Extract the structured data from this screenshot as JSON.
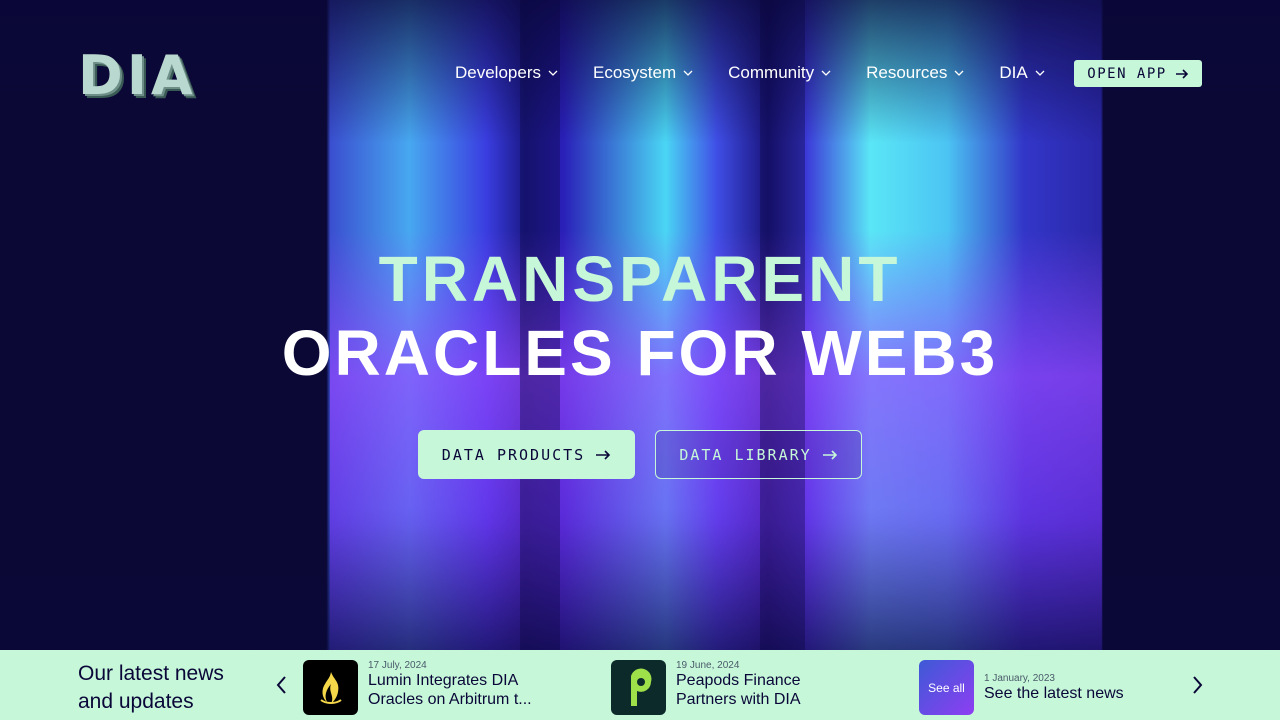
{
  "brand": {
    "logo_text": "DIA"
  },
  "nav": {
    "items": [
      {
        "label": "Developers"
      },
      {
        "label": "Ecosystem"
      },
      {
        "label": "Community"
      },
      {
        "label": "Resources"
      },
      {
        "label": "DIA"
      }
    ],
    "open_app_label": "OPEN APP"
  },
  "hero": {
    "line1": "TRANSPARENT",
    "line2": "ORACLES FOR WEB3",
    "primary_button": "DATA PRODUCTS",
    "secondary_button": "DATA LIBRARY"
  },
  "news": {
    "heading": "Our latest news and updates",
    "items": [
      {
        "date": "17 July, 2024",
        "title": "Lumin Integrates DIA Oracles on Arbitrum t...",
        "icon": "lumin-flame-icon"
      },
      {
        "date": "19 June, 2024",
        "title": "Peapods Finance Partners with DIA",
        "icon": "peapods-p-icon"
      },
      {
        "date": "1 January, 2023",
        "title": "See the latest news",
        "thumb_label": "See all"
      }
    ]
  },
  "colors": {
    "mint": "#c6f7d9",
    "navy": "#0a0738",
    "cyan": "#4ad6f4",
    "purple": "#8e3ef2"
  }
}
